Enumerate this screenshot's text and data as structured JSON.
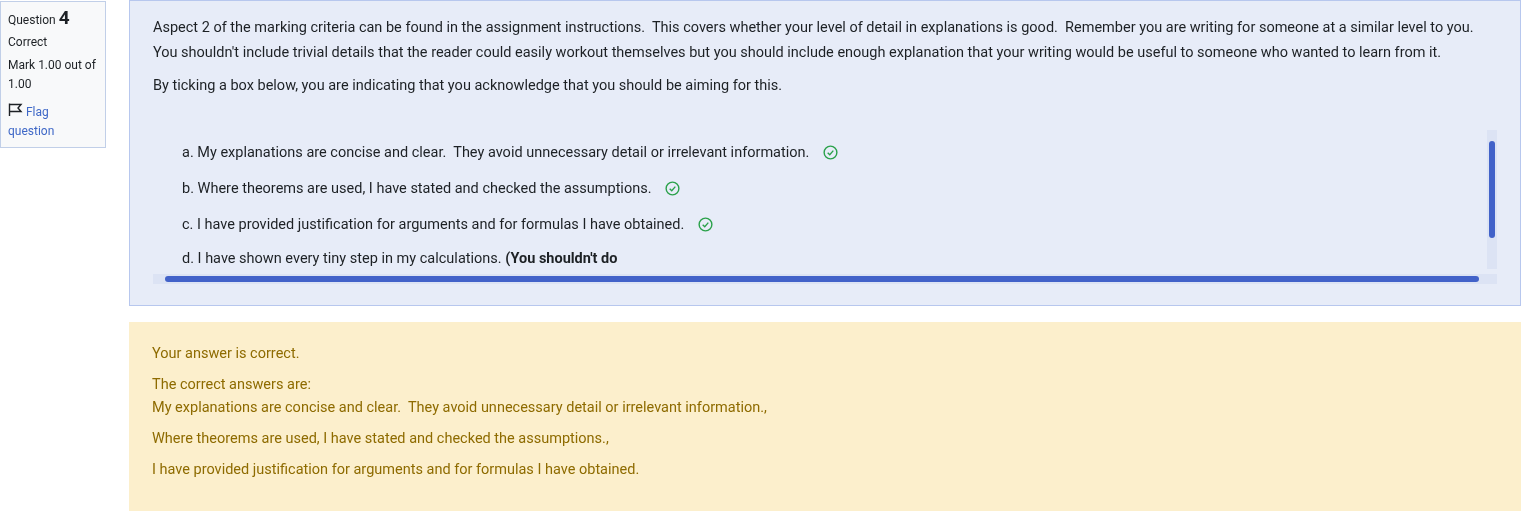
{
  "info": {
    "label": "Question",
    "number": "4",
    "state": "Correct",
    "mark": "Mark 1.00 out of 1.00",
    "flag": {
      "label": "Flag question",
      "flagged": false
    }
  },
  "question": {
    "paragraphs": [
      "Aspect 2 of the marking criteria can be found in the assignment instructions.  This covers whether your level of detail in explanations is good.  Remember you are writing for someone at a similar level to you.  You shouldn't include trivial details that the reader could easily workout themselves but you should include enough explanation that your writing would be useful to someone who wanted to learn from it.",
      "By ticking a box below, you are indicating that you acknowledge that you should be aiming for this."
    ],
    "options": [
      {
        "text": "a. My explanations are concise and clear.  They avoid unnecessary detail or irrelevant information.",
        "correct": true
      },
      {
        "text": "b. Where theorems are used, I have stated and checked the assumptions.",
        "correct": true
      },
      {
        "text": "c. I have provided justification for arguments and for formulas I have obtained.",
        "correct": true
      },
      {
        "text": "d. I have shown every tiny step in my calculations. **(You shouldn't do**",
        "correct": false
      }
    ]
  },
  "feedback": {
    "result": "Your answer is correct.",
    "heading": "The correct answers are:",
    "answers": [
      "My explanations are concise and clear.  They avoid unnecessary detail or irrelevant information.,",
      "Where theorems are used, I have stated and checked the assumptions.,",
      "I have provided justification for arguments and for formulas I have obtained."
    ]
  }
}
